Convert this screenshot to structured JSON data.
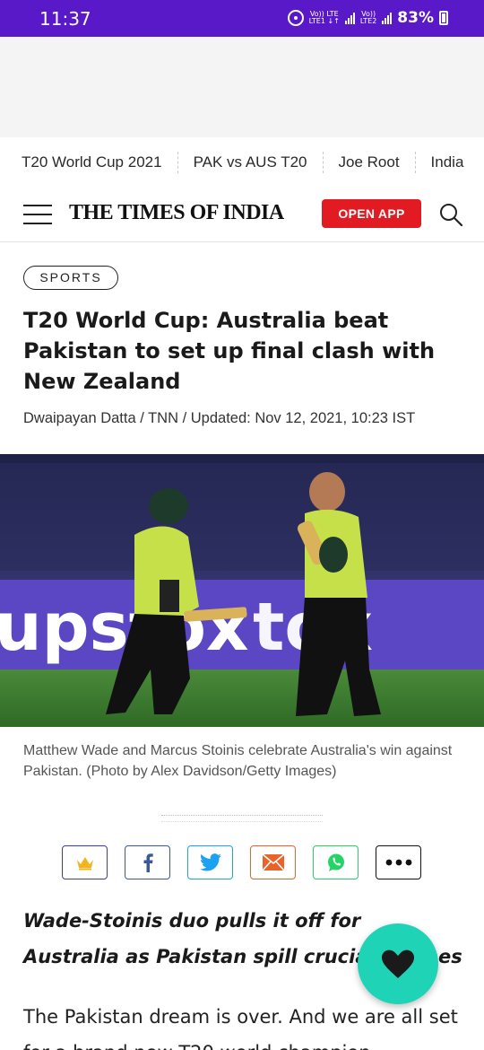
{
  "status_bar": {
    "time": "11:37",
    "sim1_top": "Vo)) LTE",
    "sim1_bottom": "LTE1 ↓↑",
    "sim2_top": "Vo))",
    "sim2_bottom": "LTE2",
    "battery": "83%"
  },
  "trending": [
    "T20 World Cup 2021",
    "PAK vs AUS T20",
    "Joe Root",
    "India"
  ],
  "header": {
    "logo": "THE TIMES OF INDIA",
    "open_app_label": "OPEN APP"
  },
  "article": {
    "tag": "SPORTS",
    "headline": "T20 World Cup: Australia beat Pakistan to set up final clash with New Zealand",
    "byline": "Dwaipayan Datta / TNN / Updated: Nov 12, 2021, 10:23 IST",
    "image_banner_text": "upstox",
    "caption": "Matthew Wade and Marcus Stoinis celebrate Australia's win against Pakistan. (Photo by Alex Davidson/Getty Images)",
    "subhead": "Wade-Stoinis duo pulls it off for Australia as Pakistan spill crucial catches",
    "body": "The Pakistan dream is over. And we are all set for a brand new T20 world champion"
  },
  "share": [
    {
      "icon": "crown-icon",
      "color": "#3d3f9e"
    },
    {
      "icon": "facebook-icon",
      "color": "#3b5998"
    },
    {
      "icon": "twitter-icon",
      "color": "#1da1f2"
    },
    {
      "icon": "mail-icon",
      "color": "#e8622a"
    },
    {
      "icon": "whatsapp-icon",
      "color": "#25d366"
    },
    {
      "icon": "more-icon",
      "color": "#111111"
    }
  ],
  "colors": {
    "status_bar": "#5a19c9",
    "open_app": "#e21b22",
    "fab": "#1ed3b6"
  }
}
